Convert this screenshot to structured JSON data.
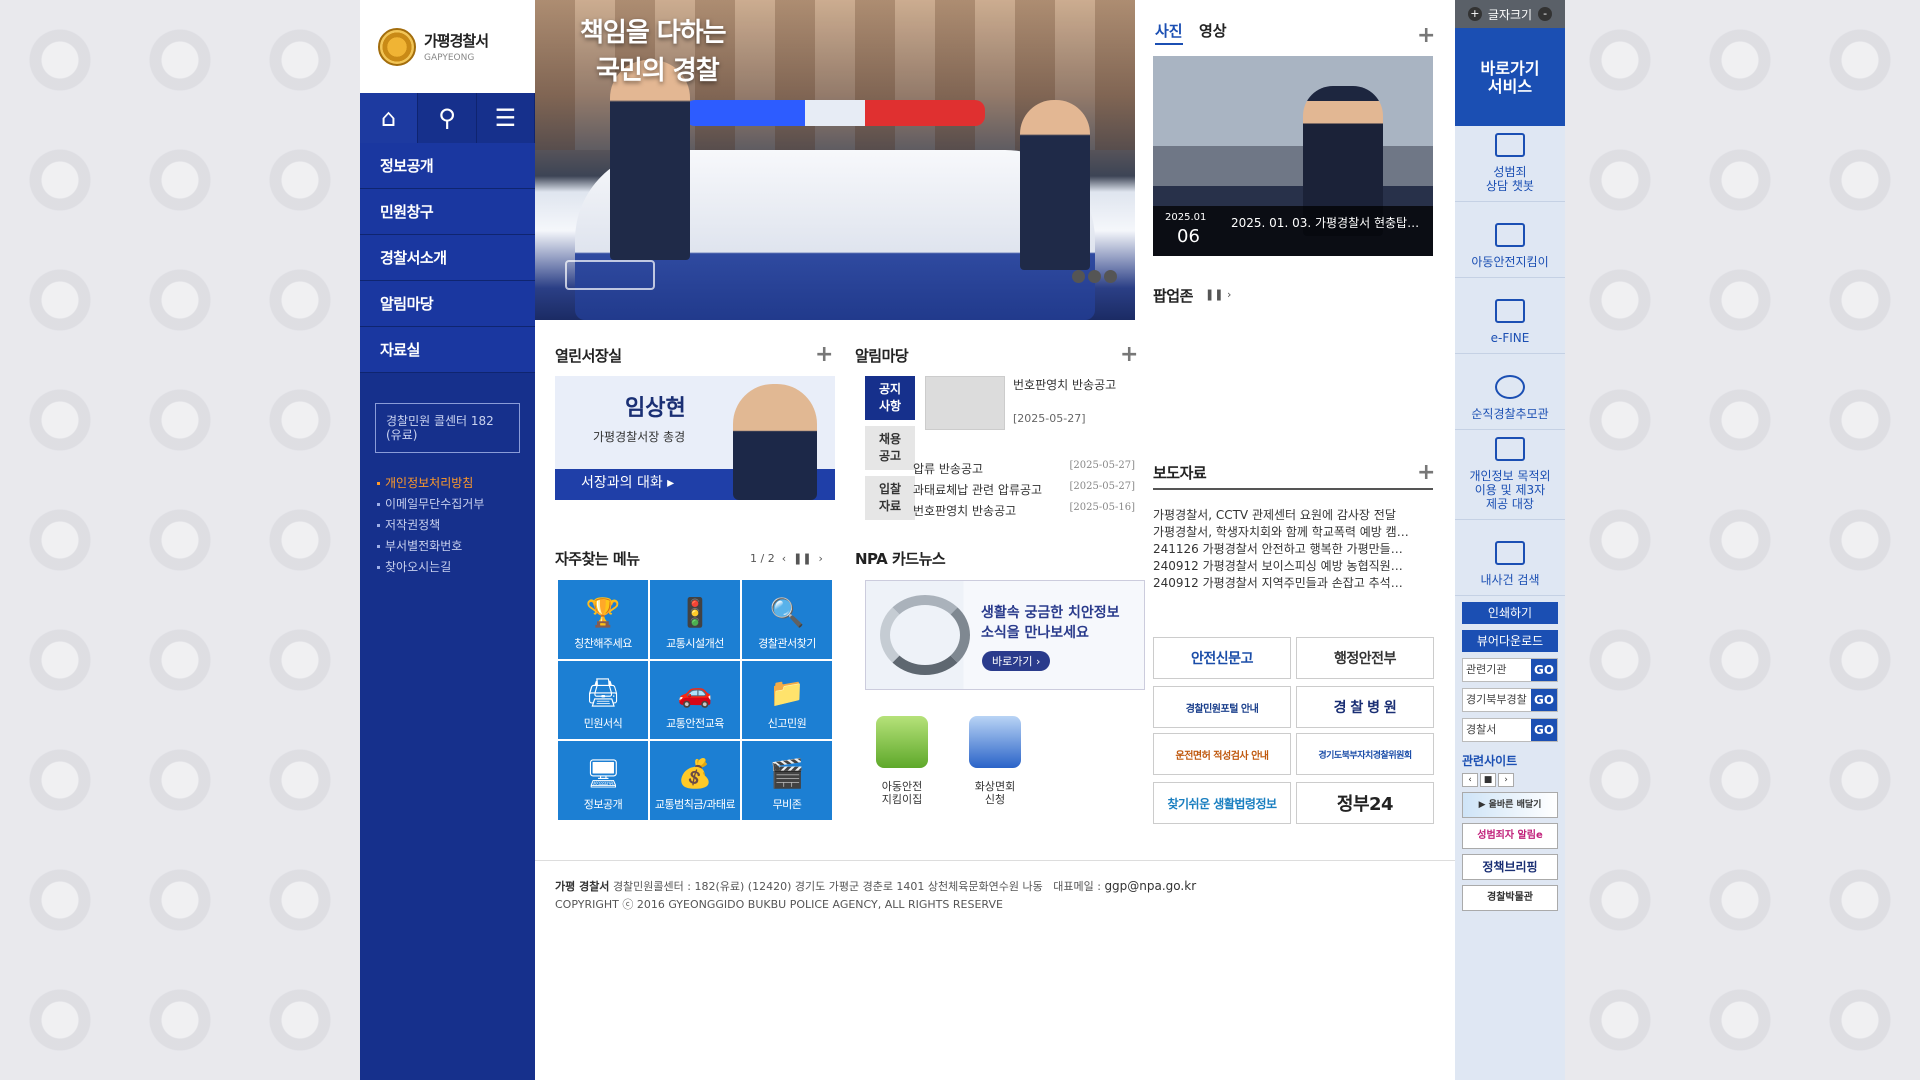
{
  "logo": {
    "name": "가평경찰서",
    "sub": "GAPYEONG"
  },
  "left_menu": [
    "정보공개",
    "민원창구",
    "경찰서소개",
    "알림마당",
    "자료실"
  ],
  "call_center": "경찰민원 콜센터 182 (유료)",
  "sub_links": [
    "개인정보처리방침",
    "이메일무단수집거부",
    "저작권정책",
    "부서별전화번호",
    "찾아오시는길"
  ],
  "hero": {
    "line1": "책임을 다하는",
    "line2": "국민의 경찰"
  },
  "sections": {
    "ceo": "열린서장실",
    "notice": "알림마당",
    "fav": "자주찾는 메뉴",
    "card": "NPA 카드뉴스",
    "popup": "팝업존",
    "press": "보도자료"
  },
  "ceo": {
    "name": "임상현",
    "rank": "가평경찰서장 총경",
    "button": "서장과의 대화 ▸"
  },
  "notice": {
    "tabs": [
      "공지\n사항",
      "채용\n공고",
      "입찰\n자료"
    ],
    "feature_title": "번호판영치 반송공고",
    "feature_date": "[2025-05-27]",
    "list": [
      {
        "title": "압류 반송공고",
        "date": "[2025-05-27]"
      },
      {
        "title": "과태료체납 관련 압류공고",
        "date": "[2025-05-27]"
      },
      {
        "title": "번호판영치 반송공고",
        "date": "[2025-05-16]"
      }
    ]
  },
  "fav_pager": "1 / 2",
  "fav_menu": [
    {
      "label": "칭찬해주세요",
      "icon": "trophy-icon",
      "glyph": "🏆"
    },
    {
      "label": "교통시설개선",
      "icon": "traffic-icon",
      "glyph": "🚦"
    },
    {
      "label": "경찰관서찾기",
      "icon": "search-icon",
      "glyph": "🔍"
    },
    {
      "label": "민원서식",
      "icon": "form-icon",
      "glyph": "🖨"
    },
    {
      "label": "교통안전교육",
      "icon": "car-icon",
      "glyph": "🚗"
    },
    {
      "label": "신고민원",
      "icon": "folder-icon",
      "glyph": "📁"
    },
    {
      "label": "정보공개",
      "icon": "monitor-icon",
      "glyph": "🖥"
    },
    {
      "label": "교통범칙금/과태료",
      "icon": "bag-icon",
      "glyph": "💰"
    },
    {
      "label": "무비존",
      "icon": "video-icon",
      "glyph": "🎬"
    }
  ],
  "card_news": {
    "text1": "생활속 궁금한 치안정보",
    "text2": "소식을 만나보세요",
    "button": "바로가기 ›"
  },
  "card_icons": [
    {
      "label": "아동안전\n지킴이집"
    },
    {
      "label": "화상면회\n신청"
    }
  ],
  "media_tabs": [
    "사진",
    "영상"
  ],
  "photo": {
    "ym": "2025.01",
    "day": "06",
    "title": "2025. 01. 03. 가평경찰서 현충탑…"
  },
  "press_items": [
    "가평경찰서, CCTV 관제센터 요원에 감사장 전달",
    "가평경찰서, 학생자치회와 함께 학교폭력 예방 캠…",
    "241126 가평경찰서 안전하고 행복한 가평만들…",
    "240912 가평경찰서 보이스피싱 예방 농협직원…",
    "240912 가평경찰서 지역주민들과 손잡고 추석…"
  ],
  "banners": [
    "안전신문고",
    "행정안전부",
    "경찰민원포털 안내",
    "경 찰 병 원",
    "운전면허 적성검사 안내",
    "경기도북부자치경찰위원회",
    "찾기쉬운 생활법령정보",
    "정부24"
  ],
  "footer": {
    "name": "가평 경찰서",
    "addr": "경찰민원콜센터 : 182(유료) (12420) 경기도 가평군 경춘로 1401 상천체육문화연수원 나동",
    "email_label": "대표메일 :",
    "email": "ggp@npa.go.kr",
    "copy": "COPYRIGHT ⓒ 2016 GYEONGGIDO BUKBU POLICE AGENCY, ALL RIGHTS RESERVE"
  },
  "quick": {
    "fontsize": "글자크기",
    "title": "바로가기\n서비스",
    "items": [
      "성범죄\n상담 챗봇",
      "아동안전지킴이",
      "e-FINE",
      "순직경찰추모관",
      "개인정보 목적외\n이용 및 제3자\n제공 대장",
      "내사건 검색"
    ],
    "print": "인쇄하기",
    "viewer": "뷰어다운로드",
    "selects": [
      "관련기관",
      "경기북부경찰",
      "경찰서"
    ],
    "go": "GO",
    "related": "관련사이트",
    "related_logos": [
      "▶ 올바른 배달기",
      "성범죄자 알림e",
      "정책브리핑",
      "경찰박물관"
    ]
  },
  "colors": {
    "navy": "#16308c",
    "menu": "#1a37a0",
    "fav": "#1c7fd3",
    "quick": "#1b4fb3",
    "accent": "#ff9a2a"
  }
}
